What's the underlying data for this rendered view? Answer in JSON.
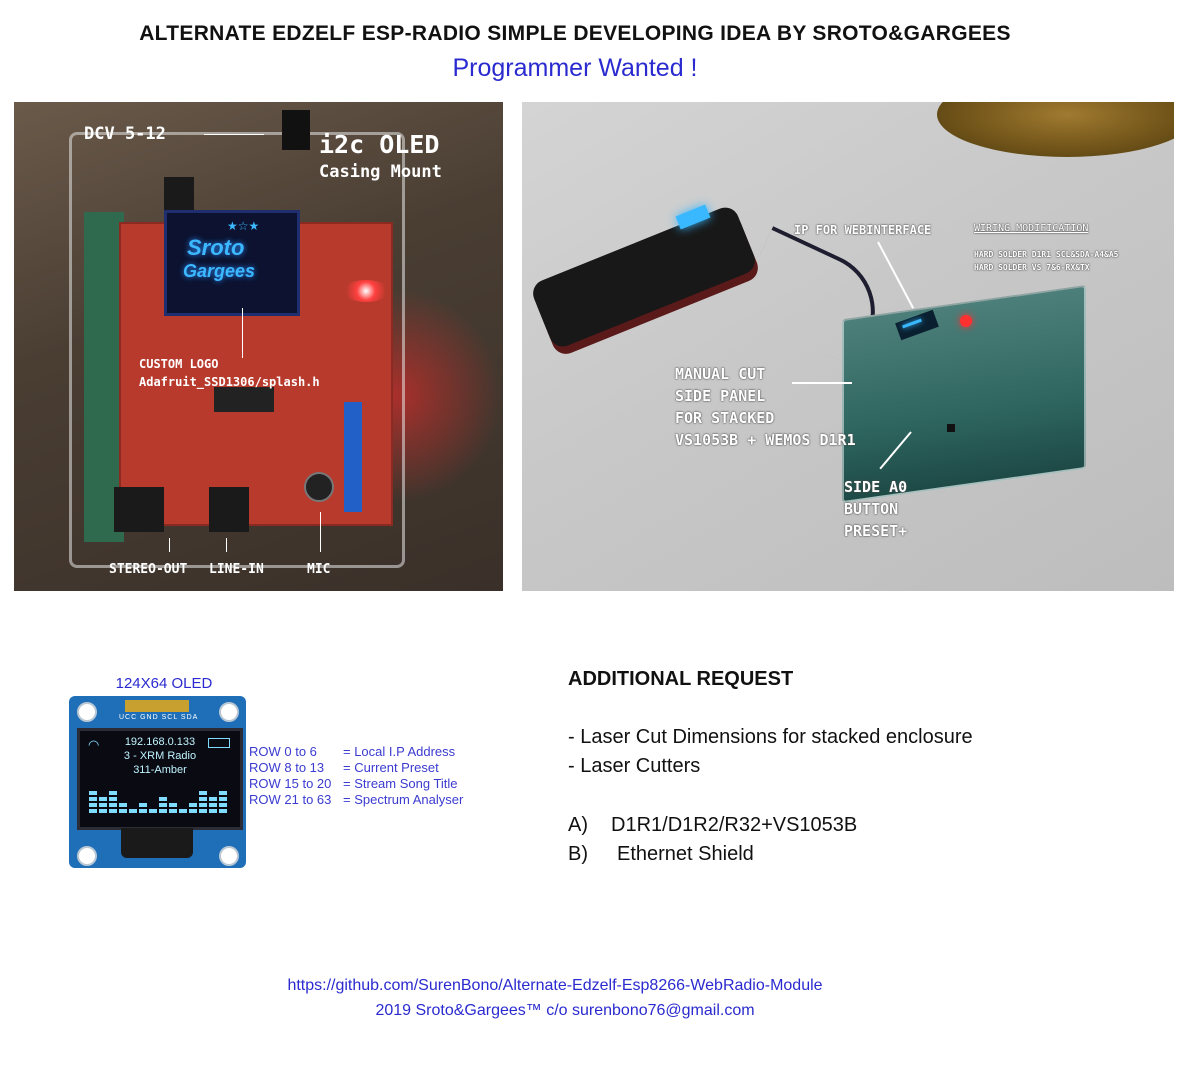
{
  "header": {
    "title": "ALTERNATE EDZELF ESP-RADIO SIMPLE DEVELOPING IDEA BY SROTO&GARGEES",
    "subtitle": "Programmer Wanted !"
  },
  "photo_left": {
    "power_label": "DCV 5-12",
    "oled_label": "i2c OLED",
    "oled_sub": "Casing Mount",
    "logo_top": "Sroto",
    "logo_bottom": "Gargees",
    "custom_logo_label": "CUSTOM LOGO",
    "splash_label": "Adafruit_SSD1306/splash.h",
    "stereo_out": "STEREO-OUT",
    "line_in": "LINE-IN",
    "mic": "MIC"
  },
  "photo_right": {
    "ip_label": "IP FOR WEBINTERFACE",
    "wiring_title": "WIRING MODIFICATION",
    "wiring_line1": "HARD SOLDER D1R1 SCL&SDA-A4&A5",
    "wiring_line2": "HARD SOLDER VS 7&6-RX&TX",
    "manual_cut_1": "MANUAL CUT",
    "manual_cut_2": "SIDE PANEL",
    "manual_cut_3": "FOR STACKED",
    "manual_cut_4": "VS1053B + WEMOS D1R1",
    "side_a0_1": "SIDE A0",
    "side_a0_2": "BUTTON",
    "side_a0_3": "PRESET+"
  },
  "oled": {
    "title": "124X64  OLED",
    "pins": "UCC GND SCL SDA",
    "line1": "192.168.0.133",
    "line2": "3 - XRM Radio",
    "line3": "311-Amber",
    "rows": [
      {
        "rows": "ROW 0 to 6",
        "desc": "= Local I.P Address"
      },
      {
        "rows": "ROW 8 to 13",
        "desc": "= Current Preset"
      },
      {
        "rows": "ROW 15 to 20",
        "desc": "= Stream Song Title"
      },
      {
        "rows": "ROW 21 to 63",
        "desc": "= Spectrum Analyser"
      }
    ]
  },
  "request": {
    "title": "ADDITIONAL REQUEST",
    "item1": "- Laser Cut Dimensions for stacked enclosure",
    "item2": "- Laser Cutters",
    "a_label": "A)",
    "a_text": "D1R1/D1R2/R32+VS1053B",
    "b_label": "B)",
    "b_text": "Ethernet Shield"
  },
  "footer": {
    "link": "https://github.com/SurenBono/Alternate-Edzelf-Esp8266-WebRadio-Module",
    "copyright": "2019 Sroto&Gargees™ c/o surenbono76@gmail.com"
  },
  "colors": {
    "accent": "#2a2ad0",
    "oled_pcb": "#1f6fb8",
    "led_red": "#ff2020"
  }
}
